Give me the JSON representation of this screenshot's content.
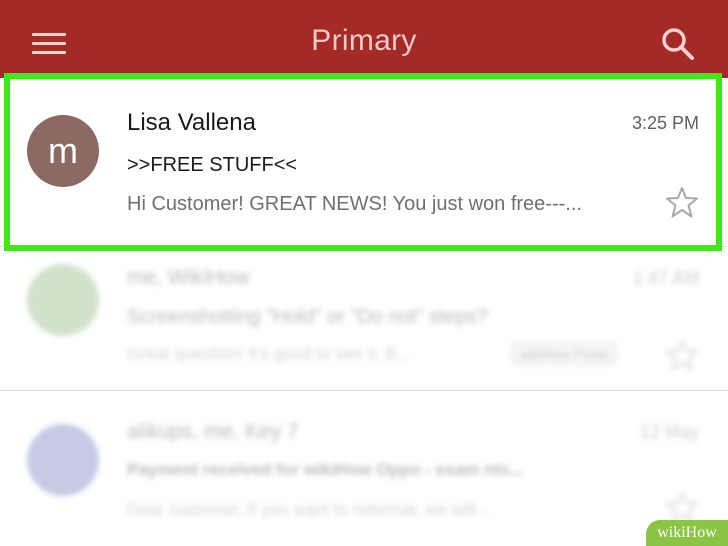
{
  "appbar": {
    "title": "Primary",
    "menu_icon": "hamburger-menu-icon",
    "search_icon": "search-icon",
    "background_color": "#a42a26"
  },
  "emails": [
    {
      "avatar_letter": "m",
      "avatar_color": "#8c6a62",
      "sender": "Lisa Vallena",
      "time": "3:25 PM",
      "subject": ">>FREE STUFF<<",
      "snippet": "Hi Customer! GREAT NEWS! You just won free---...",
      "starred": false
    },
    {
      "avatar_color": "#6a9a52",
      "sender": "me, WikiHow",
      "time": "1:47 AM",
      "subject": "Screenshotting \"Hold\" or \"Do not\" steps?",
      "snippet": "Great question! It's good to see it. B...",
      "chip": "wikiHow Posts",
      "starred": false
    },
    {
      "avatar_color": "#3e4fa8",
      "sender": "alikups, me, Key 7",
      "time": "12 May",
      "subject": "Payment received for wikiHow Oppo - exam nts...",
      "snippet": "Dear customer, If you want to reformat, we will...",
      "starred": false
    }
  ],
  "highlight_color": "#3ee81a",
  "watermark": "wikiHow"
}
